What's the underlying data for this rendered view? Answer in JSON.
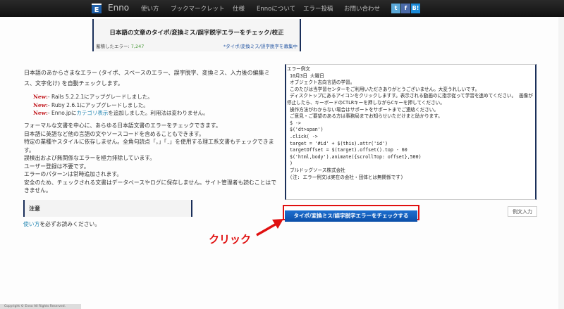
{
  "nav": {
    "logo": "E",
    "brand": "Enno",
    "items": [
      "使い方",
      "ブックマークレット",
      "仕様",
      "Ennoについて",
      "エラー投稿",
      "お問い合わせ"
    ],
    "social": [
      "t",
      "f",
      "B!"
    ]
  },
  "header": {
    "title": "日本語の文章のタイポ/変換ミス/誤字脱字エラーをチェック/校正",
    "count_label": "蓄積したエラー: ",
    "count": "7,247",
    "recruit": "*タイポ/変換ミス/誤字脱字を募集中"
  },
  "intro": "日本語のあからさまなエラー (タイポ、スペースのエラー、誤字脱字、変換ミス、入力後の編集ミス、文字化け) を自動チェックします。",
  "news": [
    {
      "tag": "New:",
      "text": "- Rails 5.2.2.1にアップグレードしました。"
    },
    {
      "tag": "New:",
      "text": "- Ruby 2.6.1にアップグレードしました。"
    },
    {
      "tag": "New:",
      "pre": "- Enno.jpに",
      "link": "カテゴリ表示",
      "post": "を追加しました。利用法は変わりません。"
    }
  ],
  "features": [
    "フォーマルな文書を中心に、あらゆる日本語文書のエラーをチェックできます。",
    "日本語に英語など他の言語の文やソースコードを含めることもできます。",
    "特定の業種やスタイルに依存しません。全角句読点「，」「．」を使用する理工系文書もチェックできます。",
    "誤検出および無関係なエラーを極力排除しています。",
    "ユーザー登録は不要です。",
    "エラーのパターンは常時追加されます。",
    "安全のため、チェックされる文書はデータベースやログに保存しません。サイト管理者も読むことはできません。"
  ],
  "textarea_lines": [
    "エラー例文",
    " 10月3日 火曜日",
    " オブジェクト志向言語の学習。",
    " このたびは当学習センターをご利用いただきありがとうございません。大変うれしいです。",
    " ディスクトップにあるアイコンをクリックしますす。表示される動画のに指示従って学習を進めてください。 画像が停止したら、キーボードのCTLRキーを押しながらCキーを押してください。",
    " 操作方法がわからない場合はサポートをサポートまでご連絡ください。",
    " ご意見・ご要望のある方は事務局までお知らせいただけまと助かります。",
    " $ ->",
    " $('dt>span')",
    " .click( ->",
    " target = '#id' + $(this).attr('id')",
    " targetOffset = $(target).offset().top - 60",
    " $('html,body').animate({scrollTop: offset},500)",
    " )",
    " ブルドッグソース株式会社",
    " (注: エラー例文は実在の会社・団体とは無関係です)"
  ],
  "check_button": "タイポ/変換ミス/誤字脱字エラーをチェックする",
  "example_button": "例文入力",
  "note": {
    "title": "注意",
    "link": "使い方",
    "text": "を必ずお読みください。"
  },
  "annotation": "クリック",
  "footer": "Copyright © Enno All Rights Reserved."
}
